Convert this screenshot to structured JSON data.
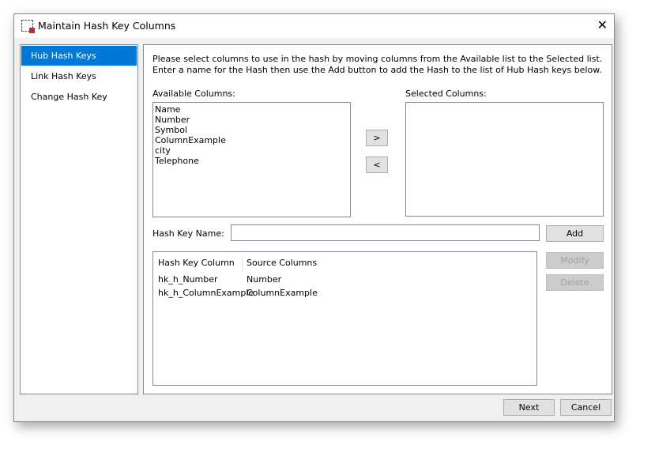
{
  "window": {
    "title": "Maintain Hash Key Columns"
  },
  "sidebar": {
    "items": [
      {
        "label": "Hub Hash Keys"
      },
      {
        "label": "Link Hash Keys"
      },
      {
        "label": "Change Hash Key"
      }
    ]
  },
  "main": {
    "instructions": "Please select columns to use in the hash by moving columns from the Available list to the Selected list. Enter a name for the Hash then use the Add button to add the Hash to the list of Hub Hash keys below.",
    "available_label": "Available Columns:",
    "available": [
      "Name",
      "Number",
      "Symbol",
      "ColumnExample",
      "city",
      "Telephone"
    ],
    "selected_label": "Selected Columns:",
    "move_right": ">",
    "move_left": "<",
    "hash_name_label": "Hash Key Name:",
    "hash_name_value": "",
    "add": "Add",
    "modify": "Modify",
    "delete": "Delete",
    "table": {
      "headers": [
        "Hash Key Column",
        "Source Columns"
      ],
      "rows": [
        [
          "hk_h_Number",
          "Number"
        ],
        [
          "hk_h_ColumnExample",
          "ColumnExample"
        ]
      ]
    }
  },
  "footer": {
    "next": "Next",
    "cancel": "Cancel"
  }
}
